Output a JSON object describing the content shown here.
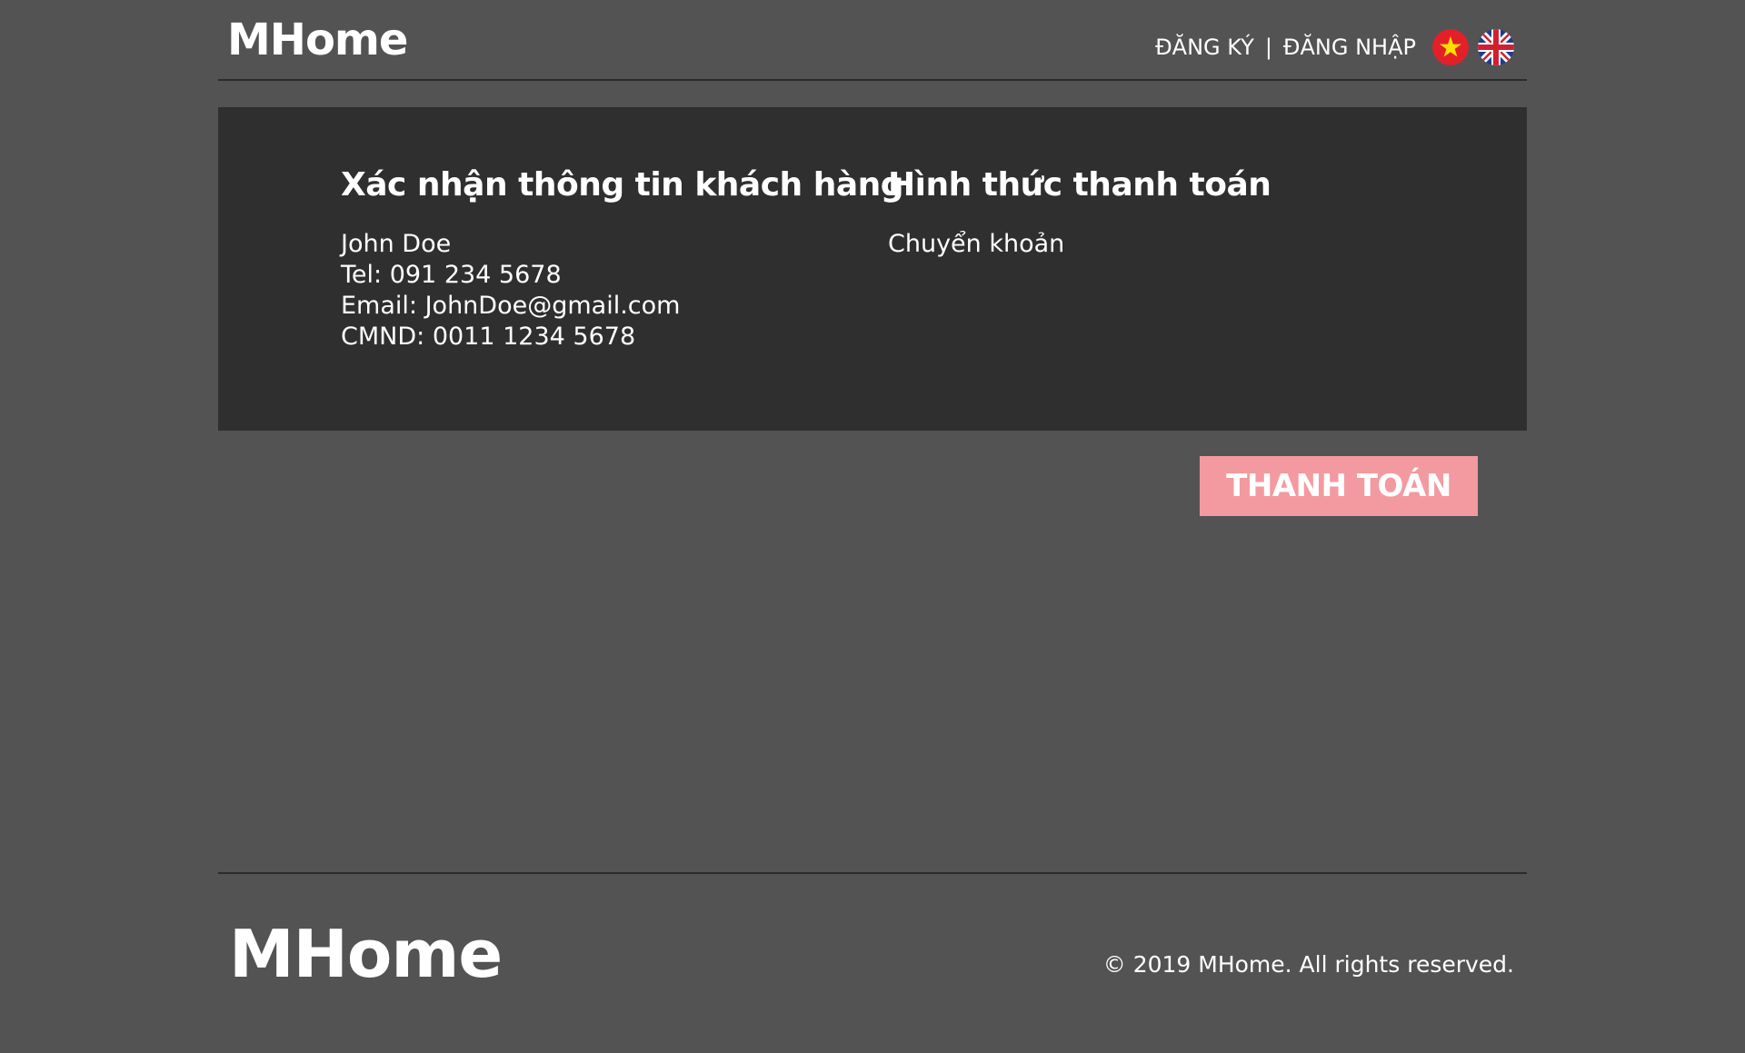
{
  "header": {
    "logo": "MHome",
    "register_label": "ĐĂNG KÝ",
    "separator": "|",
    "login_label": "ĐĂNG NHẬP",
    "flags": [
      "vietnam-flag-icon",
      "uk-flag-icon"
    ]
  },
  "customer": {
    "title": "Xác nhận thông tin khách hàng",
    "name": "John Doe",
    "tel": "Tel: 091 234 5678",
    "email": "Email: JohnDoe@gmail.com",
    "id_card": "CMND: 0011 1234 5678"
  },
  "payment": {
    "title": "Hình thức thanh toán",
    "method": "Chuyển khoản"
  },
  "actions": {
    "pay_label": "THANH TOÁN"
  },
  "footer": {
    "logo": "MHome",
    "copyright": "© 2019 MHome. All rights reserved."
  },
  "colors": {
    "background": "#535353",
    "panel": "#2f2f2f",
    "button": "#f29aa0",
    "text": "#ffffff",
    "divider": "#2b2b2b"
  }
}
